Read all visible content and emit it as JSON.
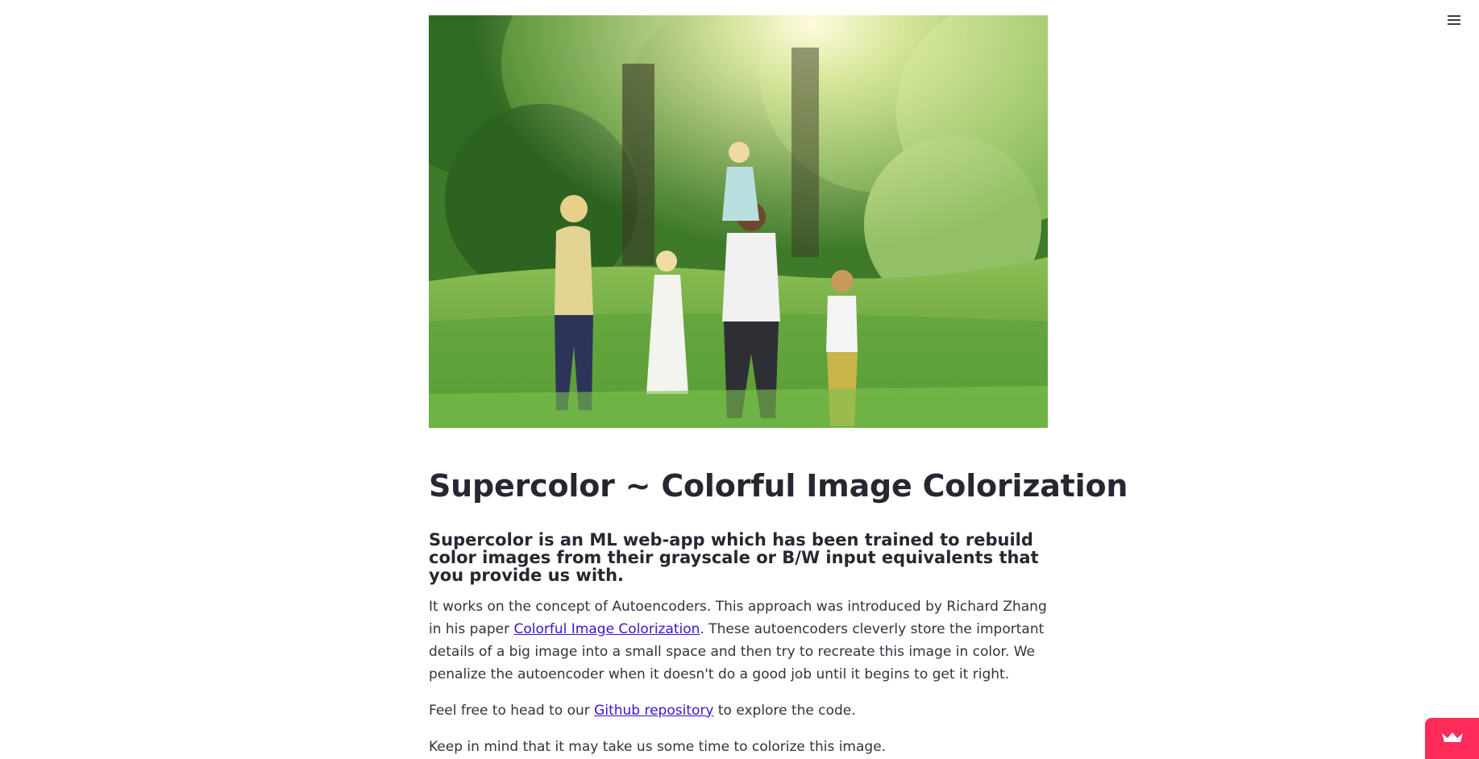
{
  "header": {
    "menu_icon": "hamburger-menu-icon"
  },
  "hero": {
    "icon": "family-in-meadow-photo"
  },
  "content": {
    "title": "Supercolor ~ Colorful Image Colorization",
    "subtitle": "Supercolor is an ML web-app which has been trained to rebuild color images from their grayscale or B/W input equivalents that you provide us with.",
    "para1_before": "It works on the concept of Autoencoders. This approach was introduced by Richard Zhang in his paper ",
    "paper_link": "Colorful Image Colorization",
    "para1_after": ". These autoencoders cleverly store the important details of a big image into a small space and then try to recreate this image in color. We penalize the autoencoder when it doesn't do a good job until it begins to get it right.",
    "para2_before": "Feel free to head to our ",
    "repo_link": "Github repository",
    "para2_after": " to explore the code.",
    "para3": "Keep in mind that it may take us some time to colorize this image."
  },
  "footer_badge": {
    "icon": "crown-icon",
    "color": "#ff2b5a"
  },
  "colors": {
    "text": "#262730",
    "link": "#3a12d6",
    "background": "#ffffff"
  }
}
